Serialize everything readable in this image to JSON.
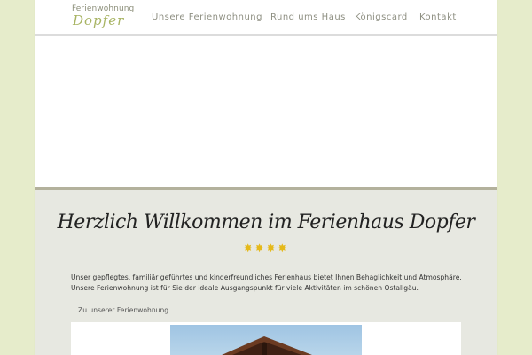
{
  "logo": {
    "top": "Ferienwohnung",
    "bottom": "Dopfer"
  },
  "nav": {
    "items": [
      {
        "label": "Unsere Ferienwohnung"
      },
      {
        "label": "Rund ums Haus"
      },
      {
        "label": "Königscard"
      },
      {
        "label": "Kontakt"
      }
    ]
  },
  "main": {
    "headline": "Herzlich Willkommen im Ferienhaus Dopfer",
    "rating_stars": 4,
    "stars_text": "✸✸✸✸",
    "paragraph_1": "Unser gepflegtes, familiär geführtes und kinderfreundliches Ferienhaus bietet Ihnen Behaglichkeit und Atmosphäre.",
    "paragraph_2": "Unsere Ferienwohnung ist für Sie der ideale Ausgangspunkt für viele Aktivitäten im schönen Ostallgäu.",
    "link_label": "Zu unserer Ferienwohnung"
  },
  "colors": {
    "page_background": "#e6eccb",
    "logo_accent": "#a8b463",
    "star_color": "#e5b91a",
    "content_background": "#e7e8e1"
  }
}
